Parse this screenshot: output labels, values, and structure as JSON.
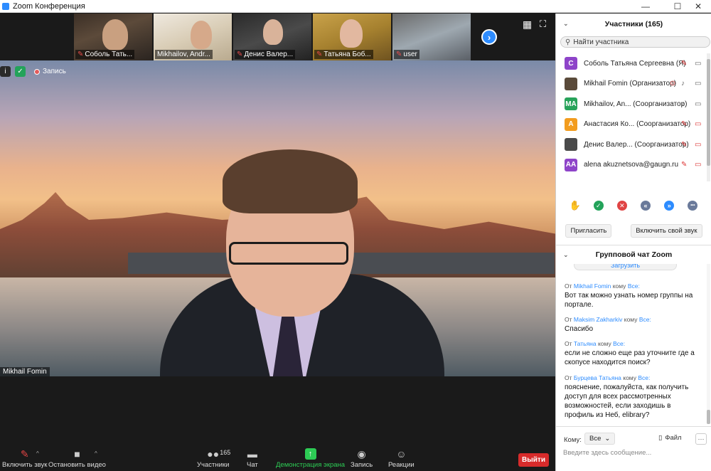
{
  "window": {
    "title": "Zoom Конференция",
    "minimize": "—",
    "maximize": "☐",
    "close": "✕"
  },
  "thumbnails": [
    {
      "label": "Соболь Тать...",
      "muted": true
    },
    {
      "label": "Mikhailov, Andr...",
      "muted": false
    },
    {
      "label": "Денис Валер...",
      "muted": true
    },
    {
      "label": "Татьяна Боб...",
      "muted": true
    },
    {
      "label": "user",
      "muted": true
    }
  ],
  "stage": {
    "next_arrow": "›",
    "gallery_glyph": "▦",
    "fullscreen_glyph": "⛶",
    "info_glyph": "i",
    "shield_glyph": "✓",
    "recording_label": "Запись",
    "speaker_name": "Mikhail Fomin"
  },
  "toolbar": {
    "unmute_label": "Включить звук",
    "stop_video_label": "Остановить видео",
    "participants_label": "Участники",
    "participants_count": "165",
    "chat_label": "Чат",
    "share_label": "Демонстрация экрана",
    "record_label": "Запись",
    "reactions_label": "Реакции",
    "leave_label": "Выйти",
    "caret": "^"
  },
  "participants_panel": {
    "title": "Участники (165)",
    "collapse_glyph": "⌄",
    "search_placeholder": "Найти участника",
    "rows": [
      {
        "initials": "С",
        "color": "#8e44c9",
        "name": "Соболь Татьяна Сергеевна (Я)",
        "mic_muted": true,
        "cam_off": false,
        "photo": false
      },
      {
        "initials": "",
        "color": "#5a4a3a",
        "name": "Mikhail Fomin (Организатор)",
        "mic_muted": false,
        "cam_off": false,
        "photo": true
      },
      {
        "initials": "MA",
        "color": "#27a35a",
        "name": "Mikhailov, An... (Соорганизатор)",
        "mic_muted": false,
        "cam_off": false,
        "photo": false
      },
      {
        "initials": "А",
        "color": "#f29c1e",
        "name": "Анастасия Ко... (Соорганизатор)",
        "mic_muted": true,
        "cam_off": true,
        "photo": false
      },
      {
        "initials": "",
        "color": "#4a4a4a",
        "name": "Денис Валер... (Соорганизатор)",
        "mic_muted": true,
        "cam_off": true,
        "photo": true
      },
      {
        "initials": "AA",
        "color": "#8e44c9",
        "name": "alena akuznetsova@gaugn.ru",
        "mic_muted": true,
        "cam_off": true,
        "photo": false
      }
    ],
    "reactions": [
      {
        "glyph": "✋",
        "color": "#2d8cff",
        "name": "raise-hand"
      },
      {
        "glyph": "✓",
        "color": "#23a35a",
        "name": "yes"
      },
      {
        "glyph": "✕",
        "color": "#e04444",
        "name": "no"
      },
      {
        "glyph": "«",
        "color": "#6a7a9a",
        "name": "slower"
      },
      {
        "glyph": "»",
        "color": "#2d8cff",
        "name": "faster"
      },
      {
        "glyph": "•••",
        "color": "#6a7a9a",
        "name": "more"
      }
    ],
    "invite_label": "Пригласить",
    "unmute_self_label": "Включить свой звук"
  },
  "chat_panel": {
    "title": "Групповой чат Zoom",
    "download_label": "Загрузить",
    "messages": [
      {
        "prefix": "От",
        "from": "Mikhail Fomin",
        "to_word": "кому",
        "to": "Все:",
        "text": "Вот так можно узнать номер группы на портале."
      },
      {
        "prefix": "От",
        "from": "Maksim Zakharkiv",
        "to_word": "кому",
        "to": "Все:",
        "text": "Спасибо"
      },
      {
        "prefix": "От",
        "from": "Татьяна",
        "to_word": "кому",
        "to": "Все:",
        "text": "если не сложно еще раз уточните где а скопусе находится поиск?"
      },
      {
        "prefix": "От",
        "from": "Бурцева Татьяна",
        "to_word": "кому",
        "to": "Все:",
        "text": "пояснение, пожалуйста, как получить доступ для всех рассмотренных возможностей, если заходишь в профиль из Неб, elibrary?"
      }
    ],
    "to_label": "Кому:",
    "to_value": "Все",
    "file_label": "Файл",
    "more_glyph": "···",
    "input_placeholder": "Введите здесь сообщение..."
  }
}
